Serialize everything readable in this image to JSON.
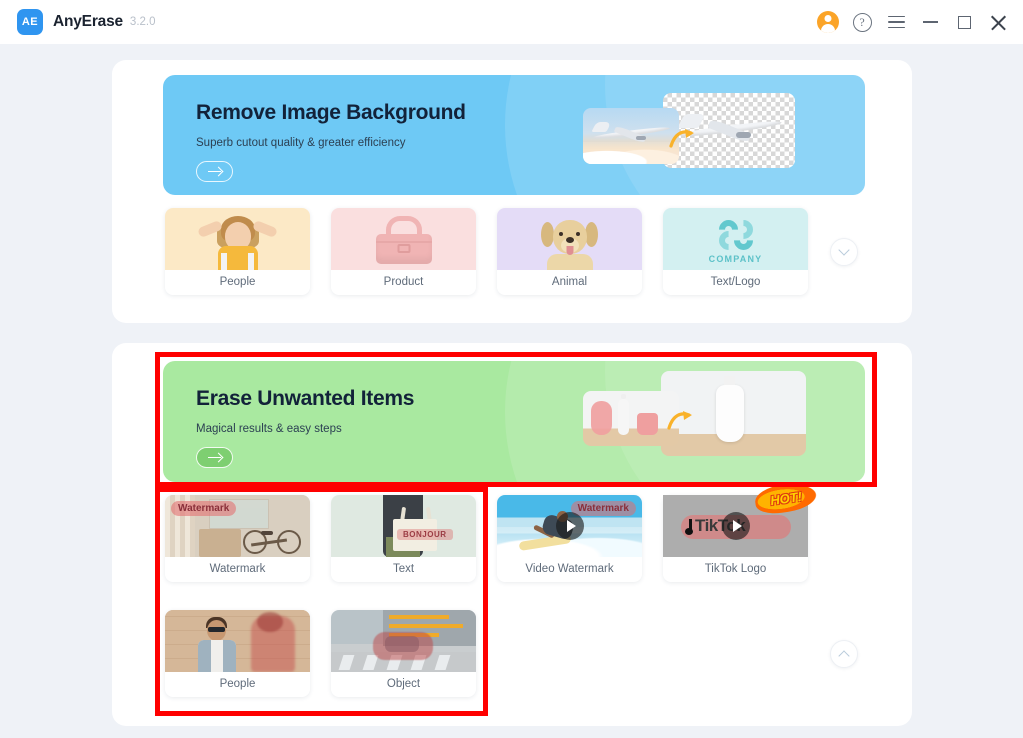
{
  "app": {
    "name": "AnyErase",
    "version": "3.2.0",
    "logo_text": "AE"
  },
  "titlebar": {
    "buttons": [
      {
        "name": "account-avatar",
        "icon": "user-avatar-icon",
        "label": ""
      },
      {
        "name": "help",
        "icon": "help-icon",
        "label": "?"
      },
      {
        "name": "menu",
        "icon": "hamburger-menu-icon",
        "label": ""
      },
      {
        "name": "minimize",
        "icon": "minimize-icon",
        "label": ""
      },
      {
        "name": "maximize",
        "icon": "maximize-icon",
        "label": ""
      },
      {
        "name": "close",
        "icon": "close-icon",
        "label": ""
      }
    ]
  },
  "sections": [
    {
      "id": "remove-background",
      "hero": {
        "title": "Remove Image Background",
        "subtitle": "Superb cutout quality & greater efficiency",
        "cta_icon": "arrow-right-icon",
        "accent": "#6ec9f5",
        "artwork": "airplane-before-after"
      },
      "expand_icon": "chevron-down-icon",
      "cards": [
        {
          "label": "People",
          "thumb": "girl-photo",
          "bg": "#fce9c6"
        },
        {
          "label": "Product",
          "thumb": "pink-bag",
          "bg": "#fadfdf"
        },
        {
          "label": "Animal",
          "thumb": "golden-dog",
          "bg": "#e4dcf7"
        },
        {
          "label": "Text/Logo",
          "thumb": "company-logo",
          "bg": "#d3f0f1",
          "logo_text": "COMPANY"
        }
      ]
    },
    {
      "id": "erase-unwanted-items",
      "hero": {
        "title": "Erase Unwanted Items",
        "subtitle": "Magical results & easy steps",
        "cta_icon": "arrow-right-icon",
        "accent": "#a9e9a0",
        "artwork": "product-before-after"
      },
      "collapse_icon": "chevron-up-icon",
      "cards": [
        {
          "label": "Watermark",
          "thumb": "bicycle-photo",
          "overlay_text": "Watermark",
          "video": false
        },
        {
          "label": "Text",
          "thumb": "tote-bag-photo",
          "overlay_text": "BONJOUR",
          "video": false
        },
        {
          "label": "Video Watermark",
          "thumb": "surfer-photo",
          "overlay_text": "Watermark",
          "video": true,
          "play_icon": "play-icon"
        },
        {
          "label": "TikTok Logo",
          "thumb": "tiktok-logo",
          "overlay_text": "TikTok",
          "video": true,
          "play_icon": "play-icon",
          "badge": "HOT!"
        },
        {
          "label": "People",
          "thumb": "man-street-photo",
          "overlay_text": "",
          "video": false
        },
        {
          "label": "Object",
          "thumb": "car-aerial-photo",
          "overlay_text": "",
          "video": false
        }
      ]
    }
  ],
  "annotations": {
    "color": "#ff0000",
    "boxes": [
      {
        "name": "erase-banner-highlight",
        "target": "erase-unwanted-items-hero"
      },
      {
        "name": "erase-image-tools-highlight",
        "target": "erase-image-card-grid"
      }
    ]
  }
}
